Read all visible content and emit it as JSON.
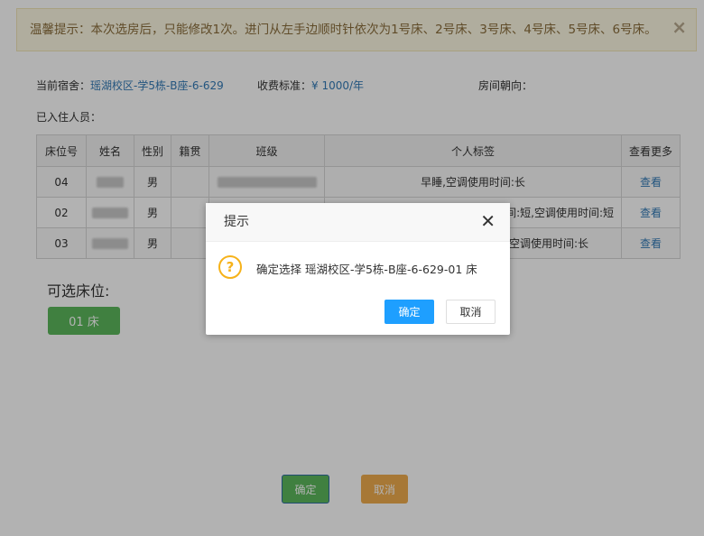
{
  "alert": {
    "text": "温馨提示：本次选房后，只能修改1次。进门从左手边顺时针依次为1号床、2号床、3号床、4号床、5号床、6号床。",
    "close": "×"
  },
  "info": {
    "dorm_label": "当前宿舍：",
    "dorm_value": "瑶湖校区-学5栋-B座-6-629",
    "fee_label": "收费标准：",
    "fee_value": "¥ 1000/年",
    "direction_label": "房间朝向："
  },
  "residents_label": "已入住人员：",
  "table": {
    "headers": [
      "床位号",
      "姓名",
      "性别",
      "籍贯",
      "班级",
      "个人标签",
      "查看更多"
    ],
    "rows": [
      {
        "bed": "04",
        "gender": "男",
        "origin": "",
        "tags": "早睡,空调使用时间:长",
        "more": "查看"
      },
      {
        "bed": "02",
        "gender": "男",
        "origin": "",
        "tags": "间:短,空调使用时间:短",
        "more": "查看"
      },
      {
        "bed": "03",
        "gender": "男",
        "origin": "",
        "tags": "空调使用时间:长",
        "more": "查看"
      }
    ]
  },
  "available": {
    "label": "可选床位:",
    "beds": [
      "01 床"
    ]
  },
  "page_buttons": {
    "confirm": "确定",
    "cancel": "取消"
  },
  "dialog": {
    "title": "提示",
    "close": "✕",
    "icon": "?",
    "message": "确定选择 瑶湖校区-学5栋-B座-6-629-01 床",
    "ok": "确定",
    "cancel": "取消"
  },
  "colors": {
    "alert_bg": "#fcf8e3",
    "alert_text": "#8a6d3b",
    "link": "#337ab7",
    "success": "#5cb85c",
    "warning": "#f0ad4e",
    "primary_dialog": "#1e9fff",
    "question_icon": "#f6b21a"
  }
}
